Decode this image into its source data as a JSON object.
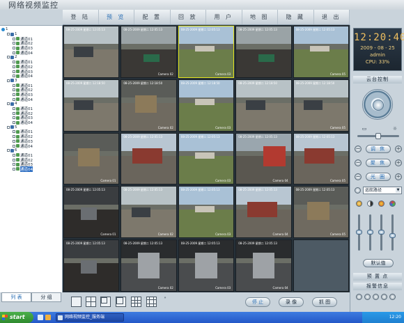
{
  "app": {
    "title": "网络视频监控"
  },
  "menu": {
    "items": [
      {
        "label": "登 陆"
      },
      {
        "label": "预 览"
      },
      {
        "label": "配 置"
      },
      {
        "label": "回 放"
      },
      {
        "label": "用 户"
      },
      {
        "label": "地 图"
      },
      {
        "label": "隐 藏"
      },
      {
        "label": "退 出"
      }
    ],
    "active_index": 1
  },
  "tree": {
    "nodes": [
      {
        "level": 0,
        "type": "root",
        "label": "1"
      },
      {
        "level": 1,
        "type": "group",
        "label": "1"
      },
      {
        "level": 2,
        "type": "cam",
        "label": "通道01"
      },
      {
        "level": 2,
        "type": "cam",
        "label": "通道02"
      },
      {
        "level": 2,
        "type": "cam",
        "label": "通道03"
      },
      {
        "level": 2,
        "type": "cam",
        "label": "通道04"
      },
      {
        "level": 1,
        "type": "group",
        "label": "2"
      },
      {
        "level": 2,
        "type": "cam",
        "label": "通道01"
      },
      {
        "level": 2,
        "type": "cam",
        "label": "通道02"
      },
      {
        "level": 2,
        "type": "cam",
        "label": "通道03"
      },
      {
        "level": 2,
        "type": "cam",
        "label": "通道04"
      },
      {
        "level": 1,
        "type": "group",
        "label": "3"
      },
      {
        "level": 2,
        "type": "cam",
        "label": "通道01"
      },
      {
        "level": 2,
        "type": "cam",
        "label": "通道02"
      },
      {
        "level": 2,
        "type": "cam",
        "label": "通道03"
      },
      {
        "level": 2,
        "type": "cam",
        "label": "通道04"
      },
      {
        "level": 1,
        "type": "group",
        "label": "4"
      },
      {
        "level": 2,
        "type": "cam",
        "label": "通道01"
      },
      {
        "level": 2,
        "type": "cam",
        "label": "通道02"
      },
      {
        "level": 2,
        "type": "cam",
        "label": "通道03"
      },
      {
        "level": 2,
        "type": "cam",
        "label": "通道04"
      },
      {
        "level": 1,
        "type": "group",
        "label": "5"
      },
      {
        "level": 2,
        "type": "cam",
        "label": "通道01"
      },
      {
        "level": 2,
        "type": "cam",
        "label": "通道02"
      },
      {
        "level": 2,
        "type": "cam",
        "label": "通道03"
      },
      {
        "level": 2,
        "type": "cam",
        "label": "通道04"
      },
      {
        "level": 1,
        "type": "group",
        "label": "6"
      },
      {
        "level": 2,
        "type": "cam",
        "label": "通道01"
      },
      {
        "level": 2,
        "type": "cam",
        "label": "通道02"
      },
      {
        "level": 2,
        "type": "cam",
        "label": "通道03"
      },
      {
        "level": 2,
        "type": "cam",
        "label": "通道04",
        "selected": true
      }
    ]
  },
  "left_tabs": [
    {
      "label": "列 表",
      "active": true
    },
    {
      "label": "分 组",
      "active": false
    }
  ],
  "video_grid": {
    "cells": [
      {
        "osd": "08-25-2009 星期二 12:05:13",
        "cam": "",
        "scene": "yard",
        "selected": false
      },
      {
        "osd": "08-25-2009 星期二 12:05:13",
        "cam": "Camera 02",
        "scene": "coal",
        "selected": false
      },
      {
        "osd": "08-25-2009 星期二 12:05:13",
        "cam": "Camera 03",
        "scene": "field",
        "selected": true
      },
      {
        "osd": "08-25-2009 星期二 12:05:13",
        "cam": "",
        "scene": "coal",
        "selected": false
      },
      {
        "osd": "08-25-2009 星期二 12:05:13",
        "cam": "Camera 05",
        "scene": "field",
        "selected": false
      },
      {
        "osd": "08-25-2009 星期二 12:18:50",
        "cam": "",
        "scene": "yard",
        "selected": false
      },
      {
        "osd": "08-25-2009 星期二 12:18:50",
        "cam": "Camera 02",
        "scene": "indoor",
        "selected": false
      },
      {
        "osd": "08-25-2009 星期二 12:18:50",
        "cam": "Camera 03",
        "scene": "field",
        "selected": false
      },
      {
        "osd": "08-25-2009 星期二 12:18:50",
        "cam": "",
        "scene": "yard",
        "selected": false
      },
      {
        "osd": "08-25-2009 星期二 12:18:50",
        "cam": "Camera 05",
        "scene": "yard",
        "selected": false
      },
      {
        "osd": "",
        "cam": "Camera 01",
        "scene": "indoor",
        "selected": false
      },
      {
        "osd": "08-25-2009 星期二 12:05:13",
        "cam": "",
        "scene": "building",
        "selected": false
      },
      {
        "osd": "08-25-2009 星期二 12:05:13",
        "cam": "Camera 03",
        "scene": "field",
        "selected": false
      },
      {
        "osd": "08-25-2009 星期二 12:05:13",
        "cam": "Camera 04",
        "scene": "truck",
        "selected": false
      },
      {
        "osd": "08-25-2009 星期二 12:05:13",
        "cam": "Camera 05",
        "scene": "building",
        "selected": false
      },
      {
        "osd": "08-25-2009 星期二 12:05:13",
        "cam": "Camera 01",
        "scene": "dark",
        "selected": false
      },
      {
        "osd": "08-25-2009 星期二 12:05:13",
        "cam": "Camera 02",
        "scene": "yard",
        "selected": false
      },
      {
        "osd": "08-25-2009 星期二 12:05:13",
        "cam": "Camera 03",
        "scene": "field",
        "selected": false
      },
      {
        "osd": "08-25-2009 星期二 12:05:13",
        "cam": "Camera 04",
        "scene": "building",
        "selected": false
      },
      {
        "osd": "08-25-2009 星期二 12:05:13",
        "cam": "Camera 05",
        "scene": "indoor",
        "selected": false
      },
      {
        "osd": "08-25-2009 星期二 12:05:13",
        "cam": "",
        "scene": "dark",
        "selected": false
      },
      {
        "osd": "08-25-2009 星期二 12:05:13",
        "cam": "Camera 02",
        "scene": "tunnel",
        "selected": false
      },
      {
        "osd": "08-25-2009 星期二 12:05:13",
        "cam": "Camera 03",
        "scene": "tunnel",
        "selected": false
      },
      {
        "osd": "08-25-2009 星期二 12:05:13",
        "cam": "Camera 04",
        "scene": "tunnel",
        "selected": false
      },
      {
        "osd": "",
        "cam": "",
        "scene": "empty",
        "selected": false
      }
    ]
  },
  "bottom_actions": {
    "stop_label": "停 止",
    "record_label": "录 像",
    "capture_label": "抓 图"
  },
  "status": {
    "time": "12:20:40",
    "date": "2009 - 08 - 25",
    "user": "admin",
    "cpu": "CPU: 33%"
  },
  "ptz": {
    "header": "云台控制",
    "controls": [
      {
        "label": "调 焦"
      },
      {
        "label": "聚 焦"
      },
      {
        "label": "光 圈"
      }
    ],
    "track_select": "巡航路径",
    "default_label": "默认值"
  },
  "preset": {
    "header": "预 置 点"
  },
  "alarm": {
    "header": "报警信息"
  },
  "taskbar": {
    "start_label": "start",
    "task_label": "网络视频监控_服务端",
    "tray_time": "12:20"
  },
  "colors": {
    "accent": "#2a6fb5",
    "panel_bg": "#c9d3db",
    "video_bg": "#27323a",
    "clock_text": "#f0c060",
    "selected_border": "#e5e51f"
  }
}
